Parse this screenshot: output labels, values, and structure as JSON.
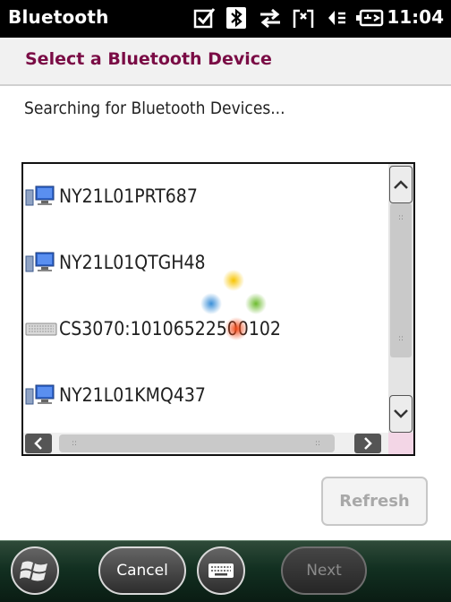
{
  "statusbar": {
    "app_title": "Bluetooth",
    "time": "11:04",
    "icons": [
      "checkbox-icon",
      "bluetooth-icon",
      "data-transfer-icon",
      "signal-off-icon",
      "speaker-icon",
      "battery-charging-icon"
    ]
  },
  "header": {
    "title": "Select a Bluetooth Device"
  },
  "status_text": "Searching for Bluetooth Devices...",
  "devices": [
    {
      "name": "NY21L01PRT687",
      "type": "computer-icon"
    },
    {
      "name": "NY21L01QTGH48",
      "type": "computer-icon"
    },
    {
      "name": "CS3070:10106522500102",
      "type": "keyboard-icon"
    },
    {
      "name": "NY21L01KMQ437",
      "type": "computer-icon"
    }
  ],
  "buttons": {
    "refresh": "Refresh"
  },
  "bottombar": {
    "cancel": "Cancel",
    "next": "Next"
  },
  "colors": {
    "accent": "#7a0c45",
    "taskbar": "#123021"
  }
}
